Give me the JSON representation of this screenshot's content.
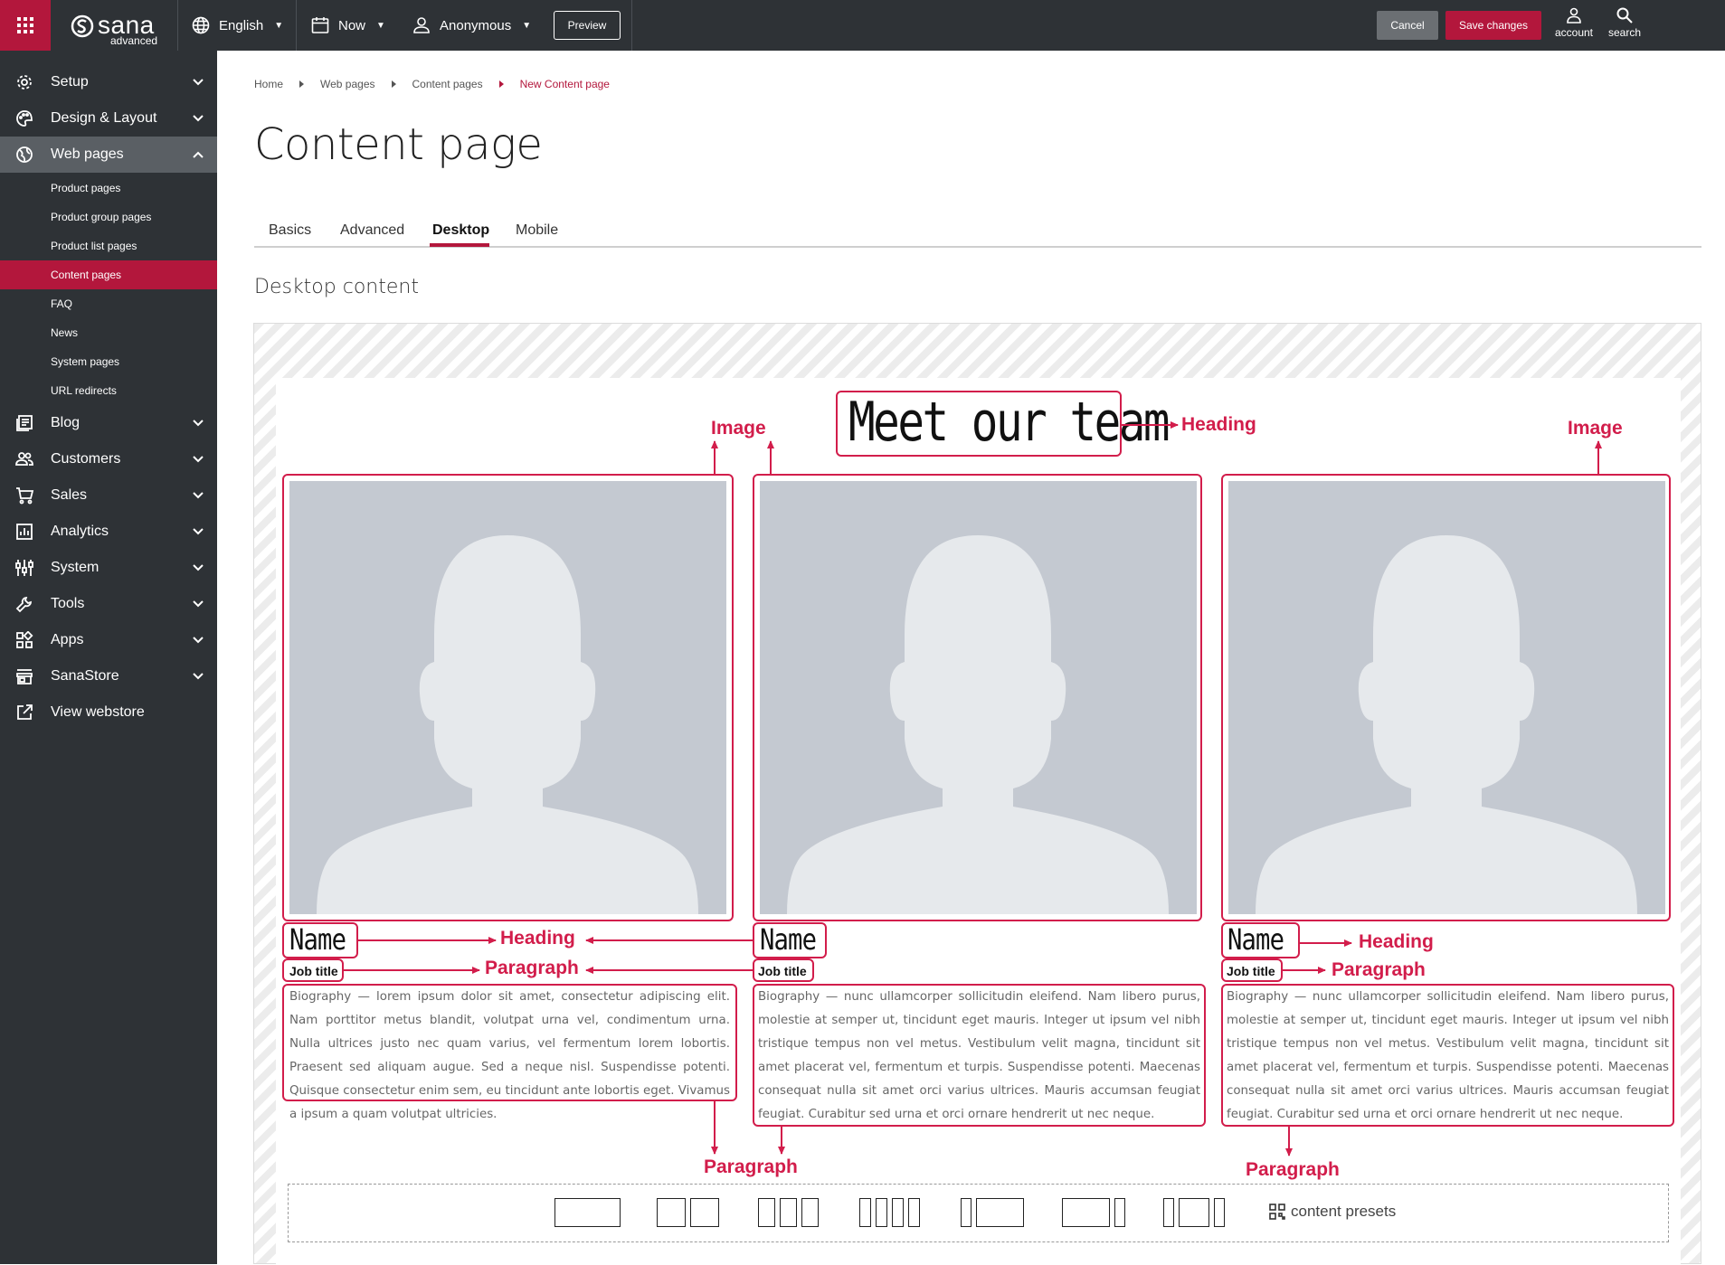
{
  "topbar": {
    "logo_text": "sana",
    "logo_sub": "advanced",
    "language": "English",
    "date": "Now",
    "user": "Anonymous",
    "preview_label": "Preview",
    "cancel_label": "Cancel",
    "save_label": "Save changes",
    "account_label": "account",
    "search_label": "search",
    "accent_color": "#b3173c"
  },
  "sidebar": {
    "items": [
      {
        "label": "Setup",
        "icon": "gear-icon"
      },
      {
        "label": "Design & Layout",
        "icon": "palette-icon"
      },
      {
        "label": "Web pages",
        "icon": "globe-icon"
      },
      {
        "label": "Blog",
        "icon": "blog-icon"
      },
      {
        "label": "Customers",
        "icon": "customers-icon"
      },
      {
        "label": "Sales",
        "icon": "cart-icon"
      },
      {
        "label": "Analytics",
        "icon": "analytics-icon"
      },
      {
        "label": "System",
        "icon": "system-icon"
      },
      {
        "label": "Tools",
        "icon": "wrench-icon"
      },
      {
        "label": "Apps",
        "icon": "apps-icon"
      },
      {
        "label": "SanaStore",
        "icon": "store-icon"
      },
      {
        "label": "View webstore",
        "icon": "external-link-icon"
      }
    ],
    "web_pages_sub": [
      "Product pages",
      "Product group pages",
      "Product list pages",
      "Content pages",
      "FAQ",
      "News",
      "System pages",
      "URL redirects"
    ]
  },
  "breadcrumb": [
    "Home",
    "Web pages",
    "Content pages",
    "New Content page"
  ],
  "page_title": "Content page",
  "tabs": [
    "Basics",
    "Advanced",
    "Desktop",
    "Mobile"
  ],
  "active_tab": "Desktop",
  "section_title": "Desktop content",
  "content": {
    "heading": "Meet our team",
    "annotations": {
      "image": "Image",
      "heading": "Heading",
      "paragraph": "Paragraph"
    },
    "members": [
      {
        "name": "Name",
        "job": "Job title",
        "bio": "Biography — lorem ipsum dolor sit amet, consectetur adipiscing elit. Nam porttitor metus blandit, volutpat urna vel, condimentum urna. Nulla ultrices justo nec quam varius, vel fermentum lorem lobortis. Praesent sed aliquam augue. Sed a neque nisl. Suspendisse potenti. Quisque consectetur enim sem, eu tincidunt ante lobortis eget. Vivamus a ipsum a quam volutpat ultricies."
      },
      {
        "name": "Name",
        "job": "Job title",
        "bio": "Biography — nunc ullamcorper sollicitudin eleifend. Nam libero purus, molestie at semper ut, tincidunt eget mauris. Integer ut ipsum vel nibh tristique tempus non vel metus. Vestibulum velit magna, tincidunt sit amet placerat vel, fermentum et turpis. Suspendisse potenti. Maecenas consequat nulla sit amet orci varius ultrices. Mauris accumsan feugiat feugiat. Curabitur sed urna et orci ornare hendrerit ut nec neque."
      },
      {
        "name": "Name",
        "job": "Job title",
        "bio": "Biography — nunc ullamcorper sollicitudin eleifend. Nam libero purus, molestie at semper ut, tincidunt eget mauris. Integer ut ipsum vel nibh tristique tempus non vel metus. Vestibulum velit magna, tincidunt sit amet placerat vel, fermentum et turpis. Suspendisse potenti. Maecenas consequat nulla sit amet orci varius ultrices. Mauris accumsan feugiat feugiat. Curabitur sed urna et orci ornare hendrerit ut nec neque."
      }
    ]
  },
  "presets_label": "content presets"
}
